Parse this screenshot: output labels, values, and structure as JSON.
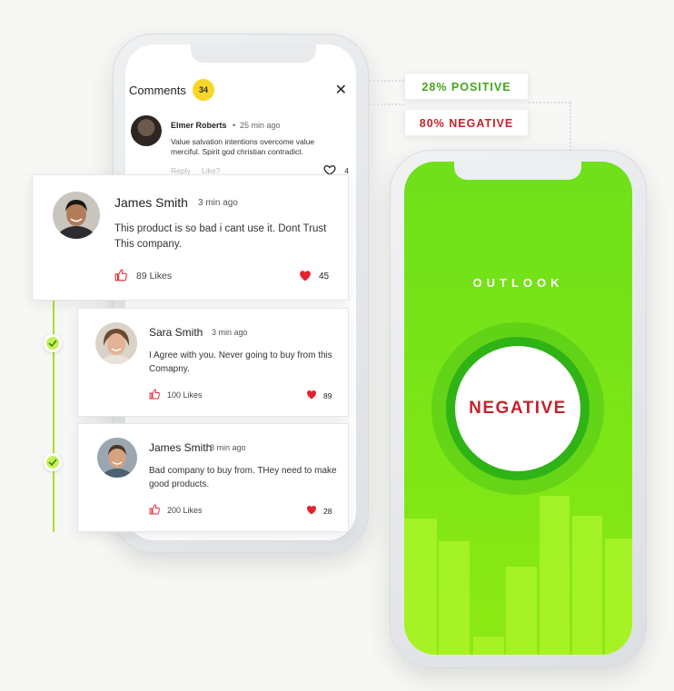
{
  "comments_panel": {
    "title": "Comments",
    "count": "34",
    "close": "✕",
    "top_comment": {
      "name": "Elmer Roberts",
      "dot": "•",
      "time": "25 min ago",
      "text": "Value salvation intentions overcome value merciful. Spirit god christian contradict.",
      "reply": "Reply",
      "like": "Like?",
      "hearts": "4"
    }
  },
  "cards": [
    {
      "name": "James Smith",
      "time": "3 min ago",
      "text": "This product is so bad i cant use it. Dont Trust This company.",
      "likes": "89 Likes",
      "hearts": "45"
    },
    {
      "name": "Sara Smith",
      "time": "3 min ago",
      "text": "I Agree with you. Never going to buy from this Comapny.",
      "likes": "100 Likes",
      "hearts": "89"
    },
    {
      "name": "James Smith",
      "time": "3 min ago",
      "text": "Bad company to buy from. THey need to make good products.",
      "likes": "200 Likes",
      "hearts": "28"
    }
  ],
  "sentiment": {
    "positive_label": "28% POSITIVE",
    "negative_label": "80% NEGATIVE",
    "outlook_title": "OUTLOOK",
    "result": "NEGATIVE"
  },
  "colors": {
    "positive": "#47a31c",
    "negative": "#c5232b",
    "screen_green": "#7de616",
    "badge_yellow": "#f6d628",
    "heart_red": "#e3222f"
  }
}
